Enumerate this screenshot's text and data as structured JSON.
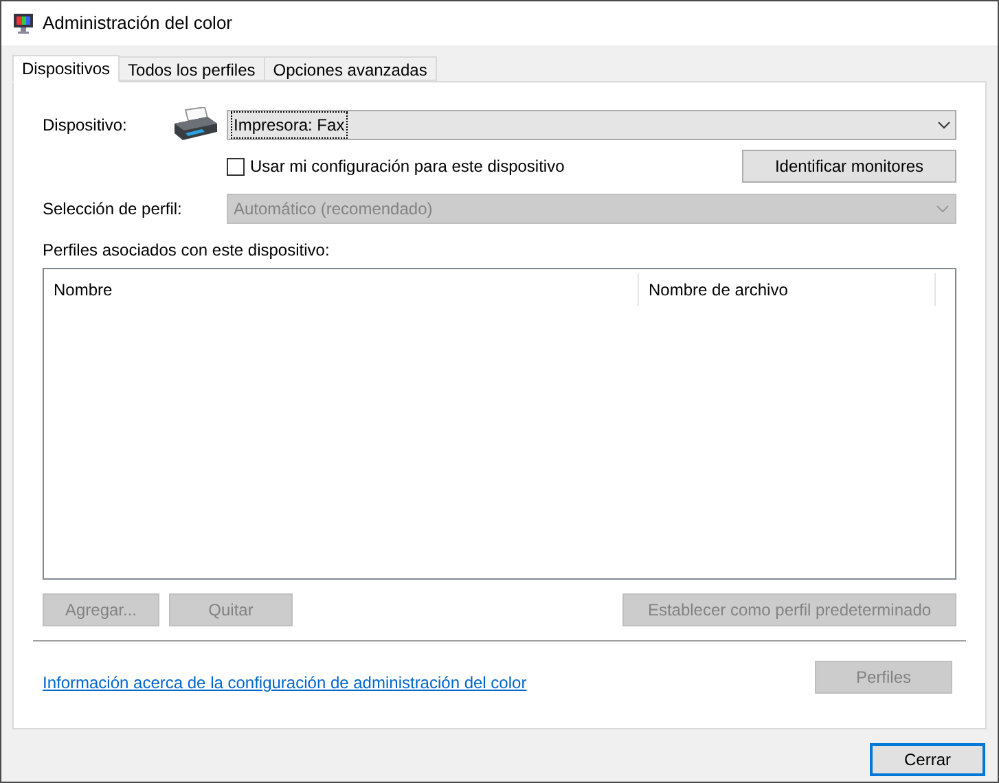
{
  "window": {
    "title": "Administración del color"
  },
  "tabs": [
    {
      "label": "Dispositivos",
      "selected": true
    },
    {
      "label": "Todos los perfiles",
      "selected": false
    },
    {
      "label": "Opciones avanzadas",
      "selected": false
    }
  ],
  "device": {
    "label": "Dispositivo:",
    "value": "Impresora: Fax"
  },
  "use_settings": {
    "label": "Usar mi configuración para este dispositivo",
    "checked": false
  },
  "identify_button": {
    "label": "Identificar monitores",
    "disabled": false
  },
  "profile_selection": {
    "label": "Selección de perfil:",
    "value": "Automático (recomendado)",
    "disabled": true
  },
  "profiles_list": {
    "label": "Perfiles asociados con este dispositivo:",
    "columns": [
      "Nombre",
      "Nombre de archivo"
    ]
  },
  "list_buttons": [
    {
      "label": "Agregar...",
      "disabled": true
    },
    {
      "label": "Quitar",
      "disabled": true
    },
    {
      "label": "Establecer como perfil predeterminado",
      "disabled": true
    }
  ],
  "info_link": "Información acerca de la configuración de administración del color",
  "profiles_button": {
    "label": "Perfiles",
    "disabled": true
  },
  "close_button": {
    "label": "Cerrar",
    "disabled": false
  }
}
